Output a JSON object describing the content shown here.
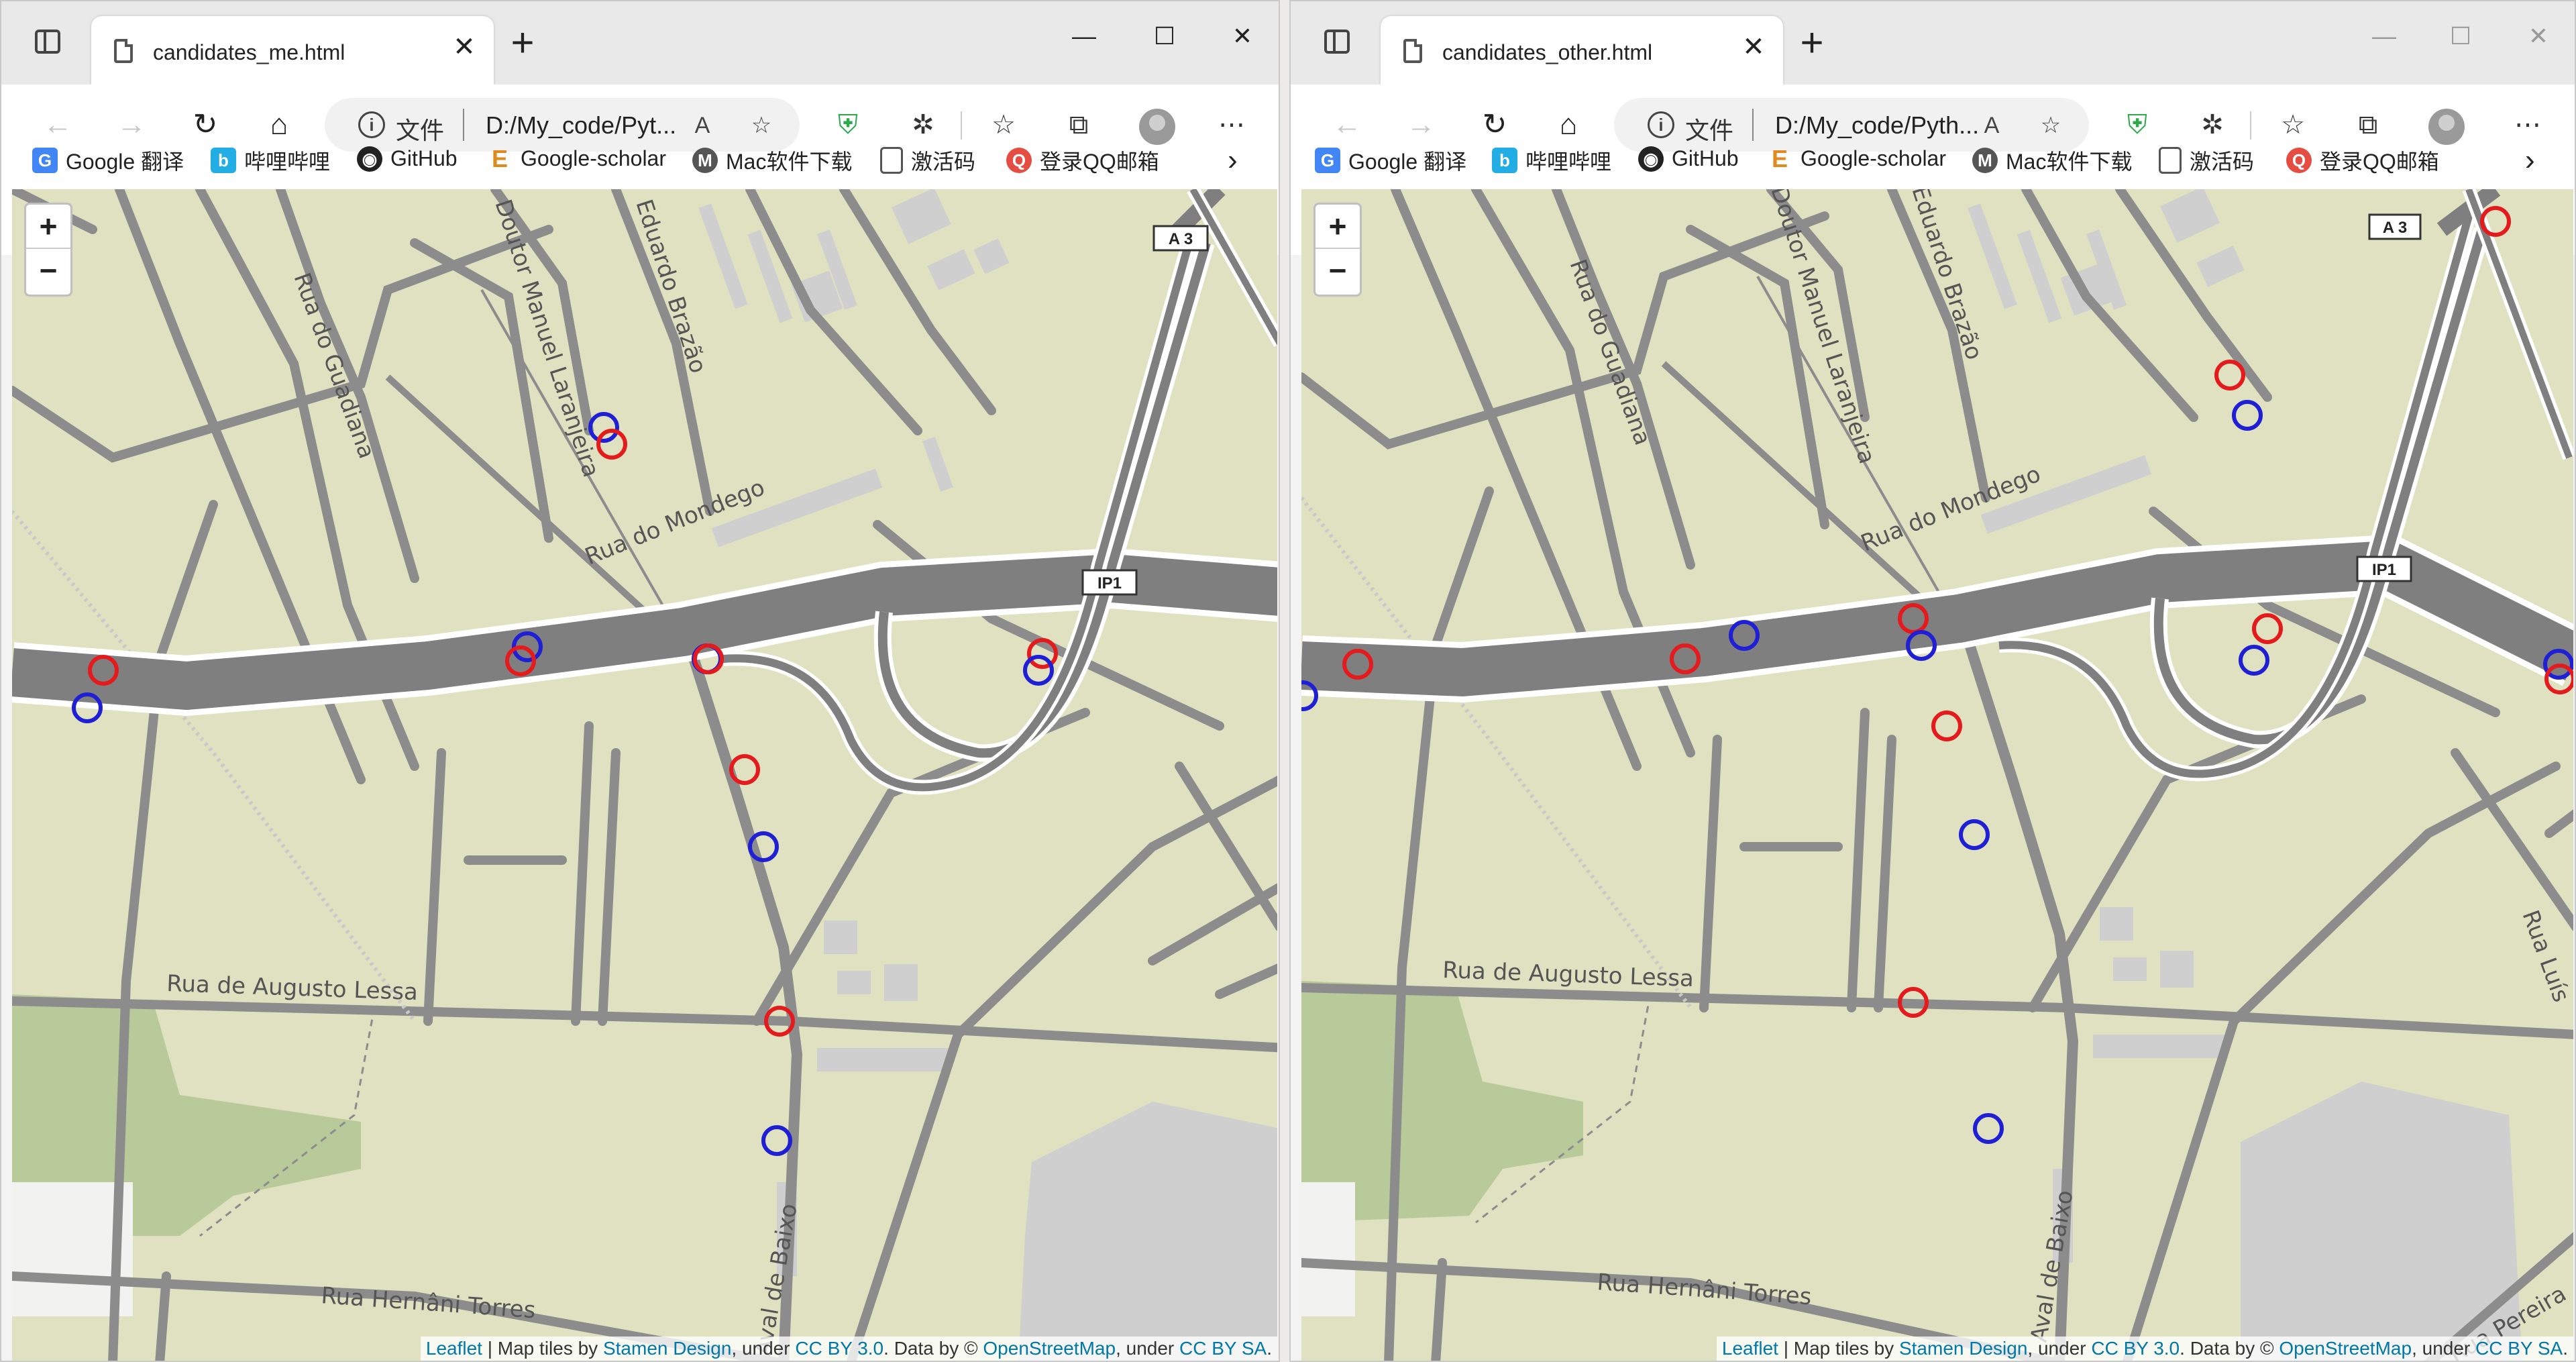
{
  "left_window": {
    "tab_title": "candidates_me.html",
    "address_scheme": "文件",
    "address_url": "D:/My_code/Pyt...",
    "attribution": {
      "leaflet": "Leaflet",
      "t1": " | Map tiles by ",
      "stamen": "Stamen Design",
      "t2": ", under ",
      "ccby": "CC BY 3.0",
      "t3": ". Data by © ",
      "osm": "OpenStreetMap",
      "t4": ", under ",
      "ccbysa": "CC BY SA",
      "t5": "."
    }
  },
  "right_window": {
    "tab_title": "candidates_other.html",
    "address_scheme": "文件",
    "address_url": "D:/My_code/Pyth...",
    "attribution": {
      "leaflet": "Leaflet",
      "t1": " | Map tiles by ",
      "stamen": "Stamen Design",
      "t2": ", under ",
      "ccby": "CC BY 3.0",
      "t3": ". Data by © ",
      "osm": "OpenStreetMap",
      "t4": ", under ",
      "ccbysa": "CC BY SA",
      "t5": "."
    }
  },
  "bookmarks": [
    {
      "label": "Google 翻译",
      "icon": "google-translate-icon",
      "color": "#4285f4"
    },
    {
      "label": "哔哩哔哩",
      "icon": "bilibili-icon",
      "color": "#23ade5"
    },
    {
      "label": "GitHub",
      "icon": "github-icon",
      "color": "#222222"
    },
    {
      "label": "Google-scholar",
      "icon": "scholar-icon",
      "color": "#e08a1e"
    },
    {
      "label": "Mac软件下载",
      "icon": "mac-download-icon",
      "color": "#555555"
    },
    {
      "label": "激活码",
      "icon": "page-icon",
      "color": "#555555"
    },
    {
      "label": "登录QQ邮箱",
      "icon": "qq-mail-icon",
      "color": "#e54d42"
    }
  ],
  "map_labels": {
    "rua_do_guadiana": "Rua do Guadiana",
    "doutor_manuel_laranjeira": "Doutor Manuel Laranjeira",
    "eduardo_brazao": "Eduardo Brazão",
    "rua_do_mondego": "Rua do Mondego",
    "rua_augusto_lessa": "Rua de Augusto Lessa",
    "rua_hernani_torres": "Rua Hernâni Torres",
    "aval_de_baixo": "Aval de Baixo",
    "a3": "A 3",
    "ip1": "IP1",
    "rua_luis": "Rua Luís",
    "rua_pereira": "Rua Pereira"
  },
  "marker_colors": {
    "candidate_red": "#e41a1c",
    "candidate_blue": "#1f1fd6"
  },
  "zoom_in": "+",
  "zoom_out": "−"
}
